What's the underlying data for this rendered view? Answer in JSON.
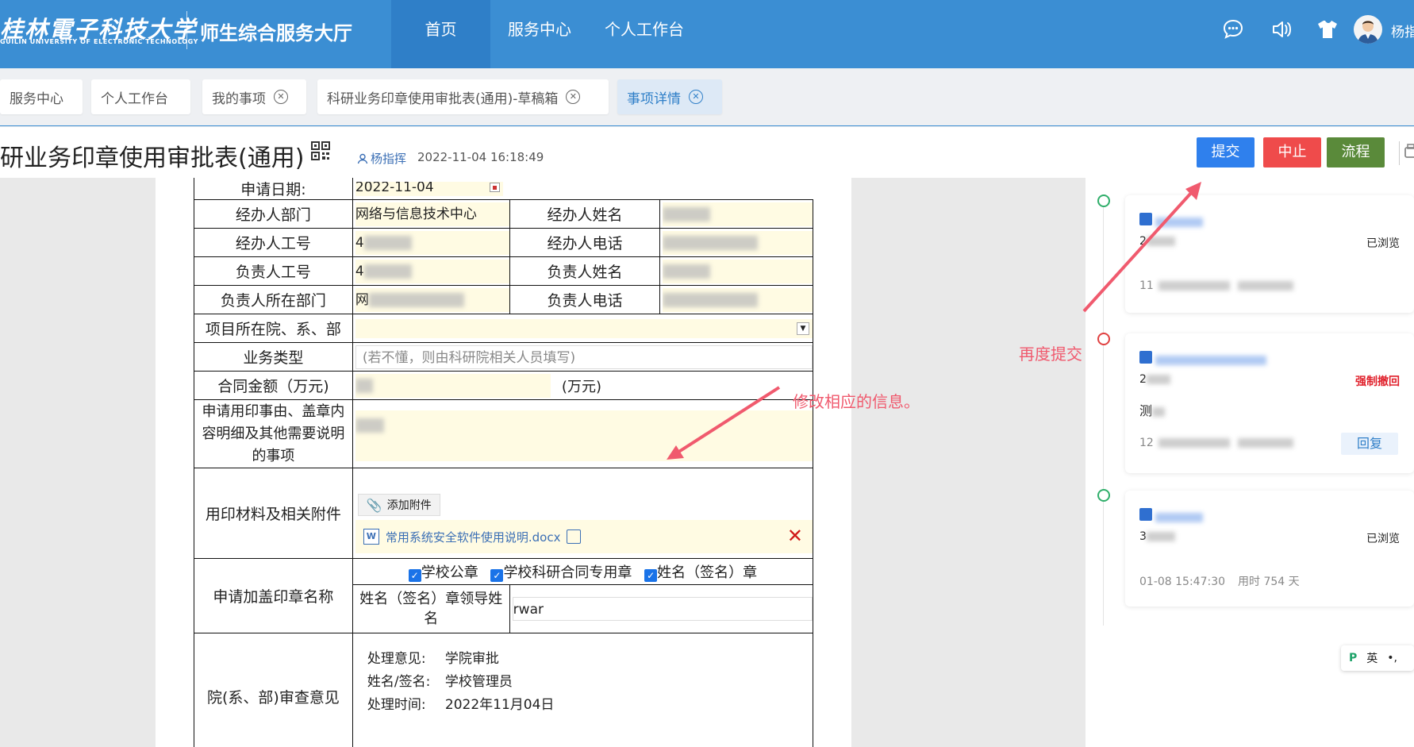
{
  "header": {
    "logo_cn": "桂林電子科技大学",
    "logo_en": "GUILIN UNIVERSITY OF ELECTRONIC TECHNOLOGY",
    "system_title": "师生综合服务大厅",
    "nav": [
      "首页",
      "服务中心",
      "个人工作台"
    ],
    "user_name": "杨指挥",
    "colors": {
      "bar": "#3b8ed3",
      "active": "#2f7fc8"
    }
  },
  "tabs": [
    {
      "label": "服务中心",
      "closable": false
    },
    {
      "label": "个人工作台",
      "closable": false
    },
    {
      "label": "我的事项",
      "closable": true
    },
    {
      "label": "科研业务印章使用审批表(通用)-草稿箱",
      "closable": true
    },
    {
      "label": "事项详情",
      "closable": true,
      "active": true
    }
  ],
  "title_row": {
    "title": "研业务印章使用审批表(通用)",
    "author": "杨指挥",
    "created": "2022-11-04 16:18:49",
    "buttons": {
      "submit": "提交",
      "stop": "中止",
      "flow": "流程"
    }
  },
  "form": {
    "apply_date_label": "申请日期:",
    "apply_date": "2022-11-04",
    "dept_label": "经办人部门",
    "dept_value": "网络与信息技术中心",
    "handler_name_label": "经办人姓名",
    "handler_id_label": "经办人工号",
    "handler_id_prefix": "4",
    "handler_phone_label": "经办人电话",
    "leader_id_label": "负责人工号",
    "leader_id_prefix": "4",
    "leader_name_label": "负责人姓名",
    "leader_dept_label": "负责人所在部门",
    "leader_dept_prefix": "网",
    "leader_phone_label": "负责人电话",
    "project_dept_label": "项目所在院、系、部",
    "biz_type_label": "业务类型",
    "biz_type_placeholder": "(若不懂，则由科研院相关人员填写)",
    "amount_label": "合同金额（万元)",
    "amount_unit": "(万元)",
    "reason_label": "申请用印事由、盖章内容明细及其他需要说明的事项",
    "attach_label": "用印材料及相关附件",
    "add_attach": "添加附件",
    "attach_file": "常用系统安全软件使用说明.docx",
    "seal_label": "申请加盖印章名称",
    "seals": [
      "学校公章",
      "学校科研合同专用章",
      "姓名（签名）章"
    ],
    "seal_leader_label": "姓名（签名）章领导姓名",
    "seal_leader_value": "rwar",
    "review_label": "院(系、部)审查意见",
    "review_opinion_label": "处理意见:",
    "review_opinion": "学院审批",
    "review_signer_label": "姓名/签名:",
    "review_signer": "学校管理员",
    "review_time_label": "处理时间:",
    "review_time": "2022年11月04日"
  },
  "timeline": [
    {
      "status": "已浏览",
      "status_color": "#222",
      "dot_color": "#2fae6a",
      "prefix": "2",
      "meta_prefix": "11"
    },
    {
      "status": "强制撤回",
      "status_color": "#e0202b",
      "dot_color": "#e04040",
      "prefix": "2",
      "comment_prefix": "测",
      "meta_prefix": "12",
      "action": "回复"
    },
    {
      "status": "已浏览",
      "status_color": "#222",
      "dot_color": "#2fae6a",
      "prefix": "3",
      "meta_time": "01-08 15:47:30",
      "meta_duration": "用时 754 天"
    }
  ],
  "annotations": {
    "resubmit": "再度提交",
    "modify": "修改相应的信息。"
  },
  "ime": {
    "label": "英"
  }
}
